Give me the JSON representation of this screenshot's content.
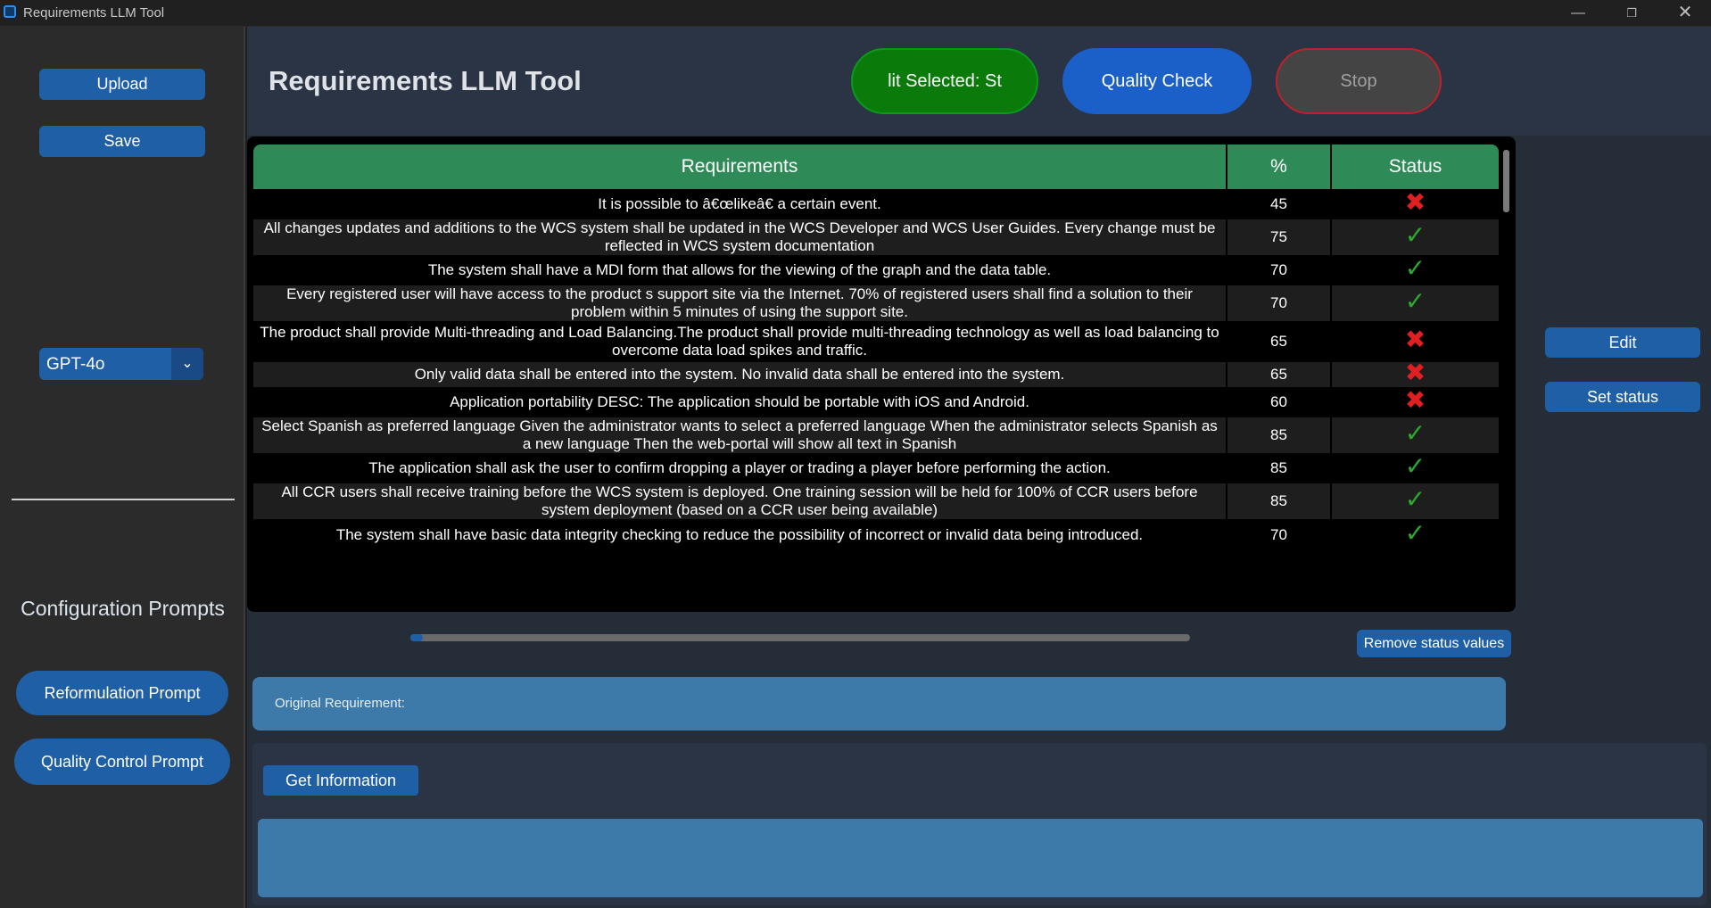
{
  "window": {
    "title": "Requirements LLM Tool",
    "min_glyph": "—",
    "max_glyph": "❐",
    "close_glyph": "✕"
  },
  "sidebar": {
    "upload_label": "Upload",
    "save_label": "Save",
    "model_value": "GPT-4o",
    "model_arrow": "⌄",
    "config_title": "Configuration Prompts",
    "reformulation_label": "Reformulation Prompt",
    "quality_control_label": "Quality Control Prompt"
  },
  "header": {
    "title": "Requirements LLM Tool",
    "split_label": "lit Selected: St",
    "quality_check_label": "Quality Check",
    "stop_label": "Stop"
  },
  "table": {
    "headers": [
      "Requirements",
      "%",
      "Status"
    ],
    "rows": [
      {
        "text": "It is possible to â€œlikeâ€ a certain event.",
        "pct": "45",
        "status": "✖",
        "ok": false
      },
      {
        "text": "All changes  updates  and additions to the WCS system shall be updated in the WCS Developer and WCS User Guides. Every change must be reflected in WCS system documentation",
        "pct": "75",
        "status": "✓",
        "ok": true
      },
      {
        "text": "The system shall have a MDI form that allows for the viewing of the graph and the data table.",
        "pct": "70",
        "status": "✓",
        "ok": true
      },
      {
        "text": "Every registered user will have access to the product s support site via the Internet.  70% of registered users shall find a solution to their problem within 5 minutes of using the support site.",
        "pct": "70",
        "status": "✓",
        "ok": true
      },
      {
        "text": "The product shall provide Multi-threading and Load Balancing.The product shall provide multi-threading technology as well as load balancing to overcome data load spikes and traffic.",
        "pct": "65",
        "status": "✖",
        "ok": false
      },
      {
        "text": "Only valid data shall be entered into the system.  No invalid data shall be entered into the system.",
        "pct": "65",
        "status": "✖",
        "ok": false
      },
      {
        "text": "Application portability DESC: The application should be portable with iOS and Android.",
        "pct": "60",
        "status": "✖",
        "ok": false
      },
      {
        "text": "Select Spanish as preferred language Given the administrator wants to select a preferred language When the administrator selects Spanish as a new language Then the web-portal will show all text in Spanish",
        "pct": "85",
        "status": "✓",
        "ok": true
      },
      {
        "text": "The application shall ask the user to confirm dropping a player or trading a player before performing the action.",
        "pct": "85",
        "status": "✓",
        "ok": true
      },
      {
        "text": "All CCR users shall receive training before the WCS system is deployed. One training session will be held for 100% of CCR users before system deployment (based on a CCR user being available)",
        "pct": "85",
        "status": "✓",
        "ok": true
      },
      {
        "text": "The system shall have basic data integrity checking to reduce the possibility of incorrect or invalid data being introduced.",
        "pct": "70",
        "status": "✓",
        "ok": true
      }
    ]
  },
  "right_panel": {
    "edit_label": "Edit",
    "set_status_label": "Set status",
    "remove_status_label": "Remove status values"
  },
  "bottom": {
    "original_requirement_label": "Original Requirement:",
    "get_information_label": "Get Information"
  },
  "colors": {
    "accent": "#1f5fa6",
    "table_header": "#2e8b57",
    "ok": "#2fa82f",
    "bad": "#e02020"
  }
}
